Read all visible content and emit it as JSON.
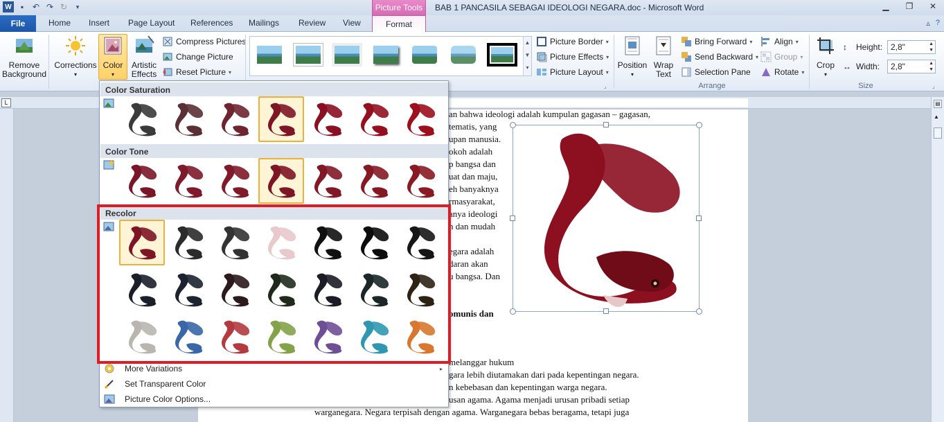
{
  "window": {
    "title": "BAB 1 PANCASILA SEBAGAI IDEOLOGI NEGARA.doc - Microsoft Word",
    "context_tab_header": "Picture Tools"
  },
  "tabs": {
    "file": "File",
    "home": "Home",
    "insert": "Insert",
    "page_layout": "Page Layout",
    "references": "References",
    "mailings": "Mailings",
    "review": "Review",
    "view": "View",
    "format": "Format"
  },
  "ribbon": {
    "remove_background": [
      "Remove",
      "Background"
    ],
    "corrections": "Corrections",
    "color": "Color",
    "artistic_effects": [
      "Artistic",
      "Effects"
    ],
    "compress_pictures": "Compress Pictures",
    "change_picture": "Change Picture",
    "reset_picture": "Reset Picture",
    "picture_border": "Picture Border",
    "picture_effects": "Picture Effects",
    "picture_layout": "Picture Layout",
    "position": "Position",
    "wrap_text": [
      "Wrap",
      "Text"
    ],
    "bring_forward": "Bring Forward",
    "send_backward": "Send Backward",
    "selection_pane": "Selection Pane",
    "align": "Align",
    "group": "Group",
    "rotate": "Rotate",
    "arrange_label": "Arrange",
    "crop": "Crop",
    "height_label": "Height:",
    "height_value": "2,8\"",
    "width_label": "Width:",
    "width_value": "2,8\"",
    "size_label": "Size"
  },
  "dropdown": {
    "color_saturation": "Color Saturation",
    "color_tone": "Color Tone",
    "recolor": "Recolor",
    "more_variations": "More Variations",
    "set_transparent_color": "Set Transparent Color",
    "picture_color_options": "Picture Color Options...",
    "saturation_colors": [
      "#3a3a3a",
      "#5a3035",
      "#6e2530",
      "#7d1525",
      "#8a0f22",
      "#94101f",
      "#9c0f1b"
    ],
    "tone_colors": [
      "#7a1628",
      "#7e1a2a",
      "#801a28",
      "#7d1525",
      "#821826",
      "#861824",
      "#8a1a22"
    ],
    "recolor_colors": [
      "#7d1525",
      "#2b2b2b",
      "#333333",
      "#e8c9cc",
      "#111111",
      "#0c0c0c",
      "#161616",
      "#1a1f2a",
      "#1d2430",
      "#2c1a1c",
      "#1f2a1c",
      "#1c1c26",
      "#1a2628",
      "#2e2214",
      "#b9b6b0",
      "#3a67a8",
      "#b33a3e",
      "#84a24a",
      "#6e4f96",
      "#2f97b0",
      "#d8772e"
    ]
  },
  "document": {
    "lines_right": [
      "an bahwa ideologi adalah kumpulan gagasan – gagasan,",
      "tematis, yang",
      "upan manusia.",
      "okoh adalah",
      "p bangsa dan",
      "uat dan maju,",
      "eh banyaknya",
      "rmasyarakat,",
      "anya ideologi",
      "n dan mudah",
      "egara adalah",
      "daran akan",
      "u bangsa. Dan",
      "omunis dan",
      "melanggar hukum",
      "gara lebih diutamakan dari pada kepentingan negara.",
      "n kebebasan dan kepentingan warga negara.",
      "usan agama. Agama menjadi urusan pribadi setiap",
      "warganegara. Negara terpisah dengan agama. Warganegara bebas beragama, tetapi juga"
    ]
  }
}
